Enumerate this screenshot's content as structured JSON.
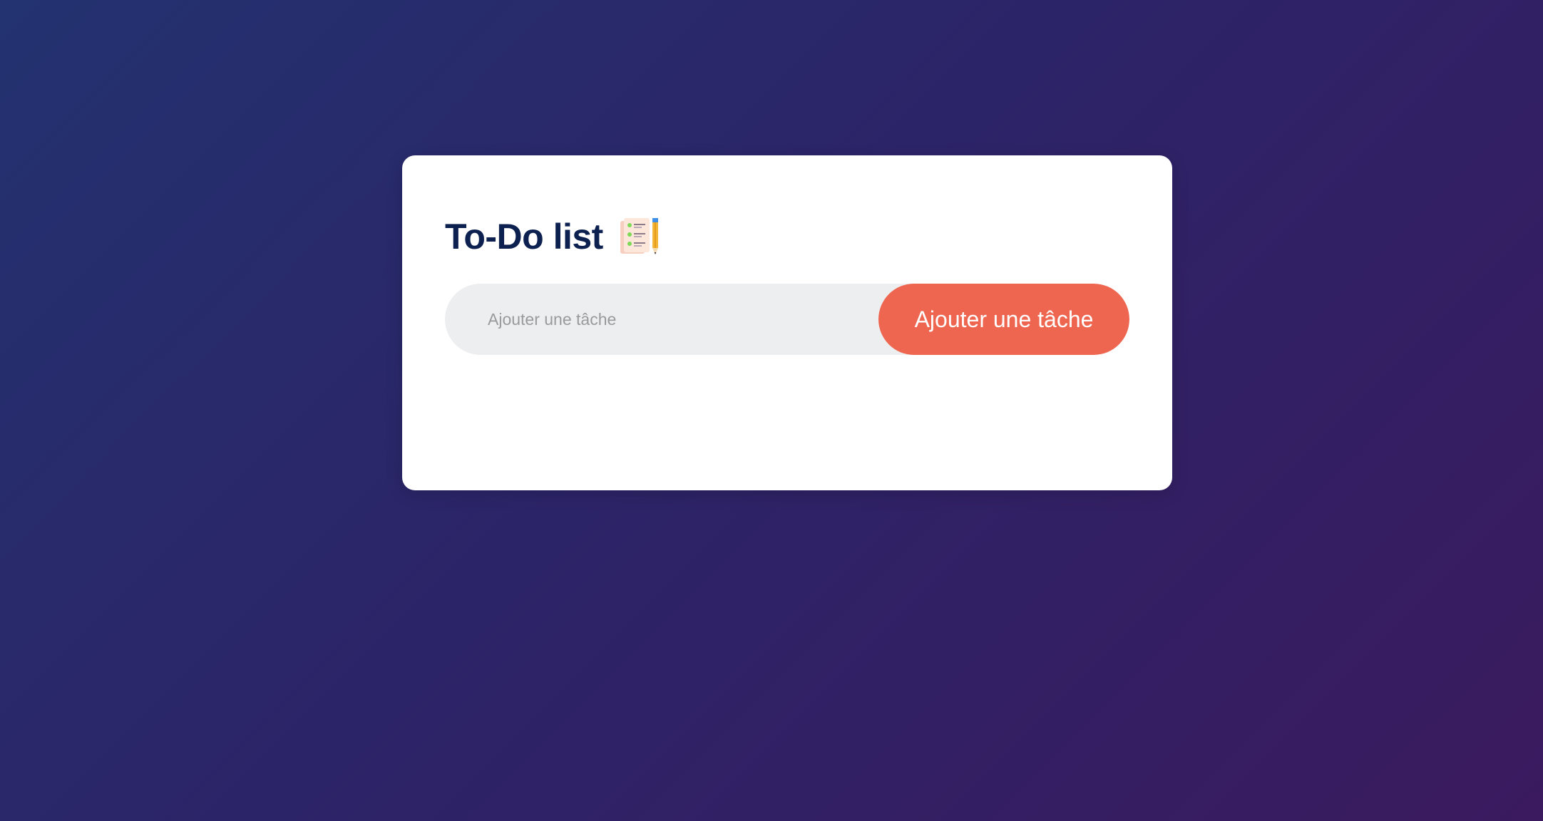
{
  "app": {
    "title": "To-Do list",
    "title_icon": "checklist-notepad-pencil-icon"
  },
  "task_input": {
    "value": "",
    "placeholder": "Ajouter une tâche"
  },
  "add_button": {
    "label": "Ajouter une tâche"
  },
  "colors": {
    "background_start": "#233270",
    "background_end": "#3b1a5f",
    "title": "#0d2151",
    "accent": "#ee6650",
    "input_bg": "#edeef0"
  },
  "tasks": []
}
